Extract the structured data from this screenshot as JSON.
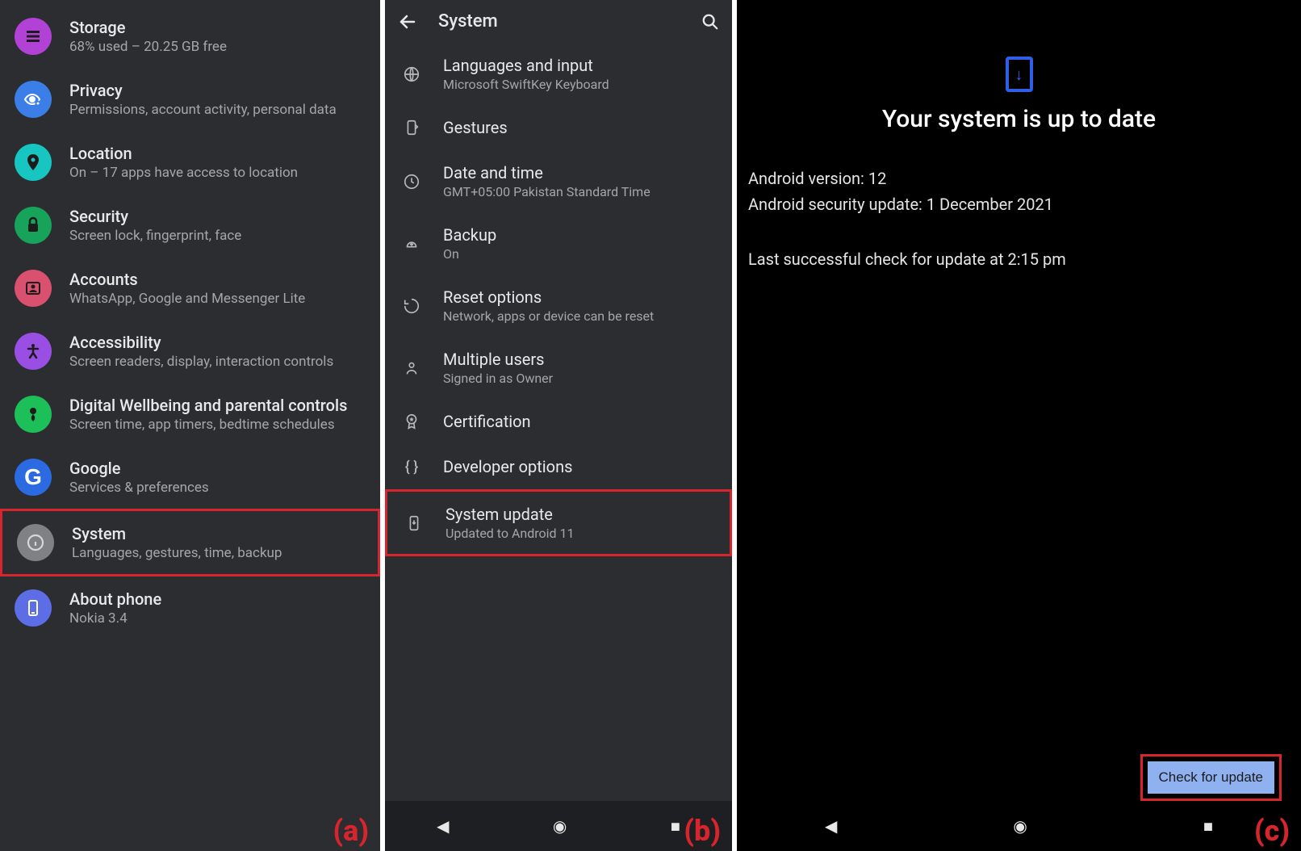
{
  "panelA": {
    "label": "(a)",
    "items": [
      {
        "title": "Storage",
        "sub": "68% used – 20.25 GB free",
        "color": "#b242d6"
      },
      {
        "title": "Privacy",
        "sub": "Permissions, account activity, personal data",
        "color": "#3b7ee8"
      },
      {
        "title": "Location",
        "sub": "On – 17 apps have access to location",
        "color": "#17c6c0"
      },
      {
        "title": "Security",
        "sub": "Screen lock, fingerprint, face",
        "color": "#18a35a"
      },
      {
        "title": "Accounts",
        "sub": "WhatsApp, Google and Messenger Lite",
        "color": "#d9516f"
      },
      {
        "title": "Accessibility",
        "sub": "Screen readers, display, interaction controls",
        "color": "#9a4fe4"
      },
      {
        "title": "Digital Wellbeing and parental controls",
        "sub": "Screen time, app timers, bedtime schedules",
        "color": "#1dbf58"
      },
      {
        "title": "Google",
        "sub": "Services & preferences",
        "color": "#2b6ae0"
      },
      {
        "title": "System",
        "sub": "Languages, gestures, time, backup",
        "color": "#7f8184",
        "highlight": true
      },
      {
        "title": "About phone",
        "sub": "Nokia 3.4",
        "color": "#5c6de6"
      }
    ]
  },
  "panelB": {
    "label": "(b)",
    "header": "System",
    "items": [
      {
        "title": "Languages and input",
        "sub": "Microsoft SwiftKey Keyboard"
      },
      {
        "title": "Gestures",
        "sub": ""
      },
      {
        "title": "Date and time",
        "sub": "GMT+05:00 Pakistan Standard Time"
      },
      {
        "title": "Backup",
        "sub": "On"
      },
      {
        "title": "Reset options",
        "sub": "Network, apps or device can be reset"
      },
      {
        "title": "Multiple users",
        "sub": "Signed in as Owner"
      },
      {
        "title": "Certification",
        "sub": ""
      },
      {
        "title": "Developer options",
        "sub": ""
      },
      {
        "title": "System update",
        "sub": "Updated to Android 11",
        "highlight": true
      }
    ]
  },
  "panelC": {
    "label": "(c)",
    "heading": "Your system is up to date",
    "line1": "Android version: 12",
    "line2": "Android security update: 1 December 2021",
    "line3": "Last successful check for update at 2:15 pm",
    "button": "Check for update"
  }
}
